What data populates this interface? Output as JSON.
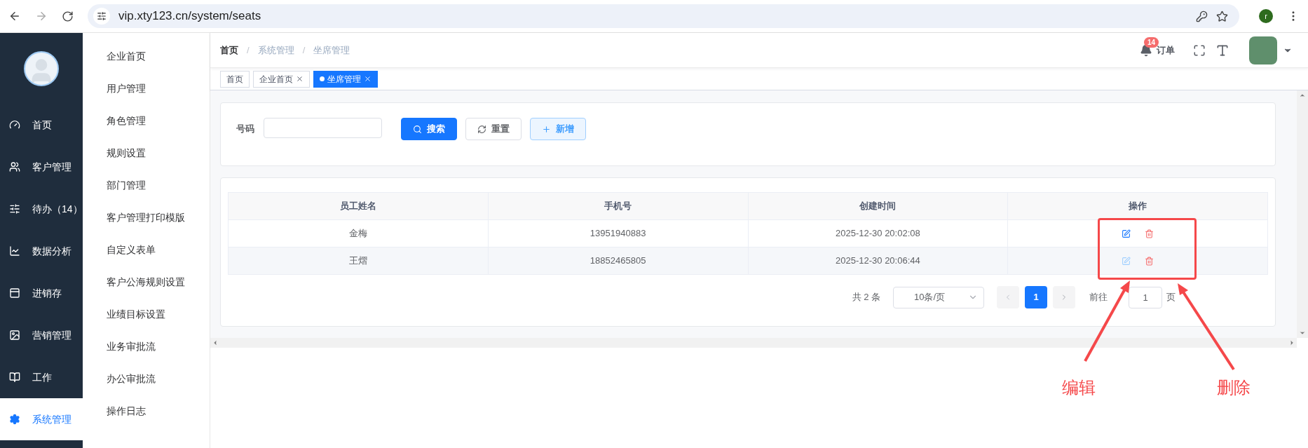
{
  "browser": {
    "url": "vip.xty123.cn/system/seats",
    "profile_initial": "r"
  },
  "sidebar": {
    "items": [
      {
        "label": "首页",
        "selected": false
      },
      {
        "label": "客户管理",
        "selected": false
      },
      {
        "label": "待办（14）",
        "selected": false
      },
      {
        "label": "数据分析",
        "selected": false
      },
      {
        "label": "进销存",
        "selected": false
      },
      {
        "label": "营销管理",
        "selected": false
      },
      {
        "label": "工作",
        "selected": false
      },
      {
        "label": "系统管理",
        "selected": true
      }
    ]
  },
  "submenu": {
    "items": [
      "企业首页",
      "用户管理",
      "角色管理",
      "规则设置",
      "部门管理",
      "客户管理打印模版",
      "自定义表单",
      "客户公海规则设置",
      "业绩目标设置",
      "业务审批流",
      "办公审批流",
      "操作日志"
    ]
  },
  "breadcrumb": [
    {
      "label": "首页",
      "kind": "link"
    },
    {
      "label": "/",
      "kind": "separator"
    },
    {
      "label": "系统管理",
      "kind": "text"
    },
    {
      "label": "/",
      "kind": "separator"
    },
    {
      "label": "坐席管理",
      "kind": "text"
    }
  ],
  "header": {
    "notification_count": "14",
    "orders_label": "订单"
  },
  "tags": [
    {
      "label": "首页",
      "selected": false,
      "closable": false
    },
    {
      "label": "企业首页",
      "selected": false,
      "closable": true
    },
    {
      "label": "坐席管理",
      "selected": true,
      "closable": true
    }
  ],
  "search": {
    "label": "号码",
    "buttons": [
      {
        "label": "搜索",
        "kind": "primary"
      },
      {
        "label": "重置",
        "kind": "default"
      },
      {
        "label": "新增",
        "kind": "plain"
      }
    ]
  },
  "table": {
    "columns": [
      "员工姓名",
      "手机号",
      "创建时间",
      "操作"
    ],
    "rows": [
      {
        "cells": [
          "金梅",
          "13951940883",
          "2025-12-30 20:02:08"
        ],
        "edit_dimmed": false
      },
      {
        "cells": [
          "王熠",
          "18852465805",
          "2025-12-30 20:06:44"
        ],
        "edit_dimmed": true
      }
    ]
  },
  "pagination": {
    "total": "共 2 条",
    "page_size": "10条/页",
    "pages": [
      {
        "label": "1",
        "selected": true
      }
    ],
    "goto_label": "前往",
    "goto_value": "1",
    "page_suffix": "页"
  },
  "annotations": [
    {
      "label": "编辑"
    },
    {
      "label": "删除"
    }
  ]
}
